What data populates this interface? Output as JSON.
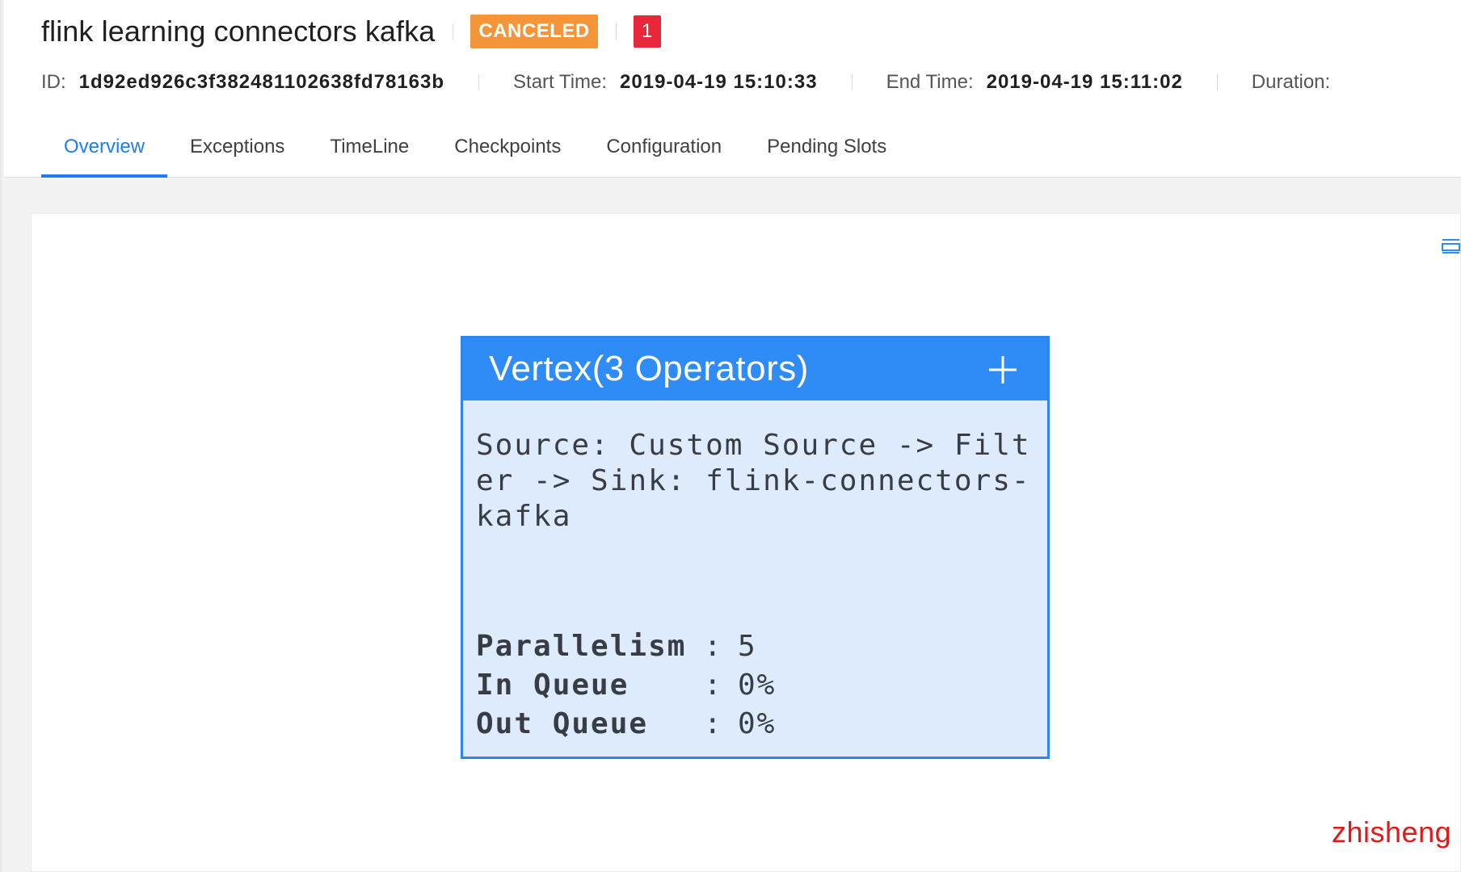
{
  "job": {
    "title": "flink learning connectors kafka",
    "status": "CANCELED",
    "count": "1",
    "status_color": "#f5953a",
    "count_color": "#e8283a"
  },
  "meta": {
    "id_label": "ID:",
    "id_value": "1d92ed926c3f382481102638fd78163b",
    "start_label": "Start Time:",
    "start_value": "2019-04-19 15:10:33",
    "end_label": "End Time:",
    "end_value": "2019-04-19 15:11:02",
    "duration_label": "Duration:"
  },
  "tabs": [
    {
      "label": "Overview",
      "active": true
    },
    {
      "label": "Exceptions",
      "active": false
    },
    {
      "label": "TimeLine",
      "active": false
    },
    {
      "label": "Checkpoints",
      "active": false
    },
    {
      "label": "Configuration",
      "active": false
    },
    {
      "label": "Pending Slots",
      "active": false
    }
  ],
  "vertex": {
    "title": "Vertex(3 Operators)",
    "description": "Source: Custom Source -> Filter -> Sink: flink-connectors-kafka",
    "stats": [
      {
        "label": "Parallelism",
        "value": "5"
      },
      {
        "label": "In Queue",
        "value": "0%"
      },
      {
        "label": "Out Queue",
        "value": "0%"
      }
    ],
    "accent_color": "#2f8cf6"
  },
  "icons": {
    "expand": "plus-icon",
    "list": "list-icon"
  },
  "watermark": "zhisheng"
}
